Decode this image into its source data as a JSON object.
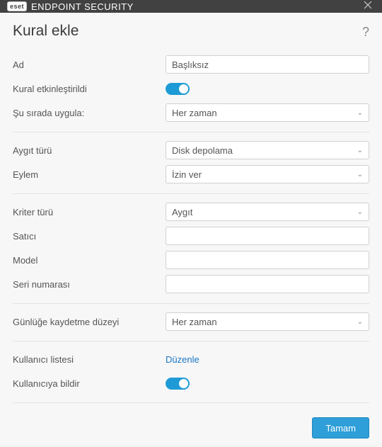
{
  "titlebar": {
    "brand_prefix": "eset",
    "brand_main": "ENDPOINT SECURITY"
  },
  "header": {
    "title": "Kural ekle",
    "help": "?"
  },
  "fields": {
    "name_label": "Ad",
    "name_value": "Başlıksız",
    "enabled_label": "Kural etkinleştirildi",
    "apply_label": "Şu sırada uygula:",
    "apply_value": "Her zaman",
    "device_type_label": "Aygıt türü",
    "device_type_value": "Disk depolama",
    "action_label": "Eylem",
    "action_value": "İzin ver",
    "criteria_label": "Kriter türü",
    "criteria_value": "Aygıt",
    "vendor_label": "Satıcı",
    "vendor_value": "",
    "model_label": "Model",
    "model_value": "",
    "serial_label": "Seri numarası",
    "serial_value": "",
    "log_label": "Günlüğe kaydetme düzeyi",
    "log_value": "Her zaman",
    "userlist_label": "Kullanıcı listesi",
    "userlist_action": "Düzenle",
    "notify_label": "Kullanıcıya bildir"
  },
  "footer": {
    "ok": "Tamam"
  }
}
